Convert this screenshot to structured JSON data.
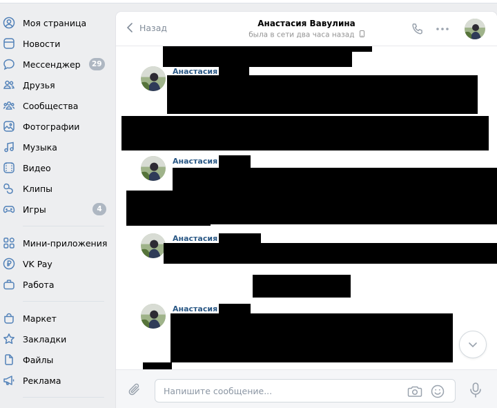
{
  "sidebar": {
    "items": [
      {
        "label": "Моя страница",
        "icon": "user-circle-icon"
      },
      {
        "label": "Новости",
        "icon": "newspaper-icon"
      },
      {
        "label": "Мессенджер",
        "icon": "message-bubble-icon",
        "badge": "29"
      },
      {
        "label": "Друзья",
        "icon": "friends-icon"
      },
      {
        "label": "Сообщества",
        "icon": "communities-icon"
      },
      {
        "label": "Фотографии",
        "icon": "photos-icon"
      },
      {
        "label": "Музыка",
        "icon": "music-note-icon"
      },
      {
        "label": "Видео",
        "icon": "video-icon"
      },
      {
        "label": "Клипы",
        "icon": "clips-icon"
      },
      {
        "label": "Игры",
        "icon": "gamepad-icon",
        "badge": "4"
      },
      {
        "label": "Мини-приложения",
        "icon": "mini-apps-icon"
      },
      {
        "label": "VK Pay",
        "icon": "vk-pay-icon"
      },
      {
        "label": "Работа",
        "icon": "briefcase-icon"
      },
      {
        "label": "Маркет",
        "icon": "shopping-bag-icon"
      },
      {
        "label": "Закладки",
        "icon": "star-icon"
      },
      {
        "label": "Файлы",
        "icon": "file-icon"
      },
      {
        "label": "Реклама",
        "icon": "megaphone-icon"
      }
    ]
  },
  "header": {
    "back_label": "Назад",
    "title": "Анастасия Вавулина",
    "status": "была в сети два часа назад"
  },
  "messages": [
    {
      "sender": "Анастасия"
    },
    {
      "sender": "Анастасия"
    },
    {
      "sender": "Анастасия"
    },
    {
      "sender": "Анастасия"
    }
  ],
  "composer": {
    "placeholder": "Напишите сообщение..."
  },
  "colors": {
    "background": "#edeef0",
    "link": "#2a5885",
    "icon": "#5181b8",
    "badge": "#aeb7c2"
  }
}
